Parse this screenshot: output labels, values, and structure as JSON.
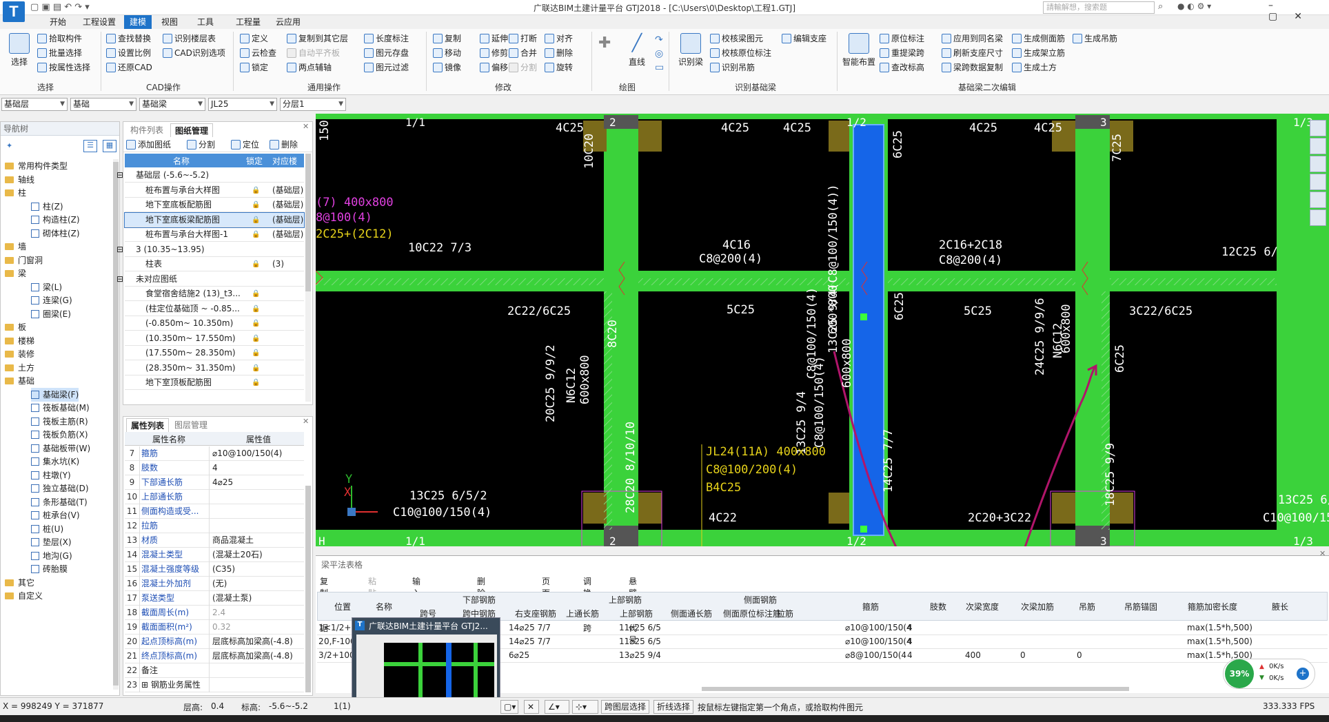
{
  "window": {
    "title": "广联达BIM土建计量平台 GTJ2018 - [C:\\Users\\0\\Desktop\\工程1.GTJ]",
    "logo": "T",
    "search_placeholder": "請輸解想，搜索题"
  },
  "menu": [
    "开始",
    "工程设置",
    "建模",
    "视图",
    "工具",
    "工程量",
    "云应用"
  ],
  "ribbon": {
    "select": {
      "label": "选择",
      "group": "选择",
      "items": [
        "拾取构件",
        "批量选择",
        "按属性选择"
      ]
    },
    "cad": {
      "group": "CAD操作",
      "items": [
        "查找替换",
        "设置比例",
        "还原CAD",
        "识别楼层表",
        "CAD识别选项"
      ]
    },
    "general": {
      "group": "通用操作",
      "items": [
        "定义",
        "云检查",
        "锁定",
        "复制到其它层",
        "自动平齐板",
        "两点辅轴",
        "长度标注",
        "图元存盘",
        "图元过滤"
      ]
    },
    "modify": {
      "group": "修改",
      "items": [
        "复制",
        "延伸",
        "打断",
        "对齐",
        "移动",
        "修剪",
        "合并",
        "删除",
        "镜像",
        "偏移",
        "分割",
        "旋转"
      ]
    },
    "draw": {
      "group": "绘图",
      "items": [
        "直线"
      ]
    },
    "recog": {
      "group": "识别基础梁",
      "items": [
        "识别梁",
        "校核梁图元",
        "校核原位标注",
        "识别吊筋",
        "编辑支座"
      ]
    },
    "beam2": {
      "group": "基础梁二次编辑",
      "items": [
        "智能布置",
        "原位标注",
        "重提梁跨",
        "查改标高",
        "应用到同名梁",
        "刷新支座尺寸",
        "梁跨数据复制",
        "生成侧面筋",
        "生成架立筋",
        "生成土方",
        "生成吊筋"
      ]
    }
  },
  "selectors": [
    "基础层",
    "基础",
    "基础梁",
    "JL25",
    "分层1"
  ],
  "nav": {
    "title": "导航树",
    "items": [
      {
        "label": "常用构件类型",
        "type": "folder"
      },
      {
        "label": "轴线",
        "type": "folder"
      },
      {
        "label": "柱",
        "type": "folder"
      },
      {
        "label": "柱(Z)",
        "type": "sub"
      },
      {
        "label": "构造柱(Z)",
        "type": "sub"
      },
      {
        "label": "砌体柱(Z)",
        "type": "sub"
      },
      {
        "label": "墙",
        "type": "folder"
      },
      {
        "label": "门窗洞",
        "type": "folder"
      },
      {
        "label": "梁",
        "type": "folder"
      },
      {
        "label": "梁(L)",
        "type": "sub"
      },
      {
        "label": "连梁(G)",
        "type": "sub"
      },
      {
        "label": "圈梁(E)",
        "type": "sub"
      },
      {
        "label": "板",
        "type": "folder"
      },
      {
        "label": "楼梯",
        "type": "folder"
      },
      {
        "label": "装修",
        "type": "folder"
      },
      {
        "label": "土方",
        "type": "folder"
      },
      {
        "label": "基础",
        "type": "folder"
      },
      {
        "label": "基础梁(F)",
        "type": "sub",
        "sel": true
      },
      {
        "label": "筏板基础(M)",
        "type": "sub"
      },
      {
        "label": "筏板主筋(R)",
        "type": "sub"
      },
      {
        "label": "筏板负筋(X)",
        "type": "sub"
      },
      {
        "label": "基础板带(W)",
        "type": "sub"
      },
      {
        "label": "集水坑(K)",
        "type": "sub"
      },
      {
        "label": "柱墩(Y)",
        "type": "sub"
      },
      {
        "label": "独立基础(D)",
        "type": "sub"
      },
      {
        "label": "条形基础(T)",
        "type": "sub"
      },
      {
        "label": "桩承台(V)",
        "type": "sub"
      },
      {
        "label": "桩(U)",
        "type": "sub"
      },
      {
        "label": "垫层(X)",
        "type": "sub"
      },
      {
        "label": "地沟(G)",
        "type": "sub"
      },
      {
        "label": "砖胎膜",
        "type": "sub"
      },
      {
        "label": "其它",
        "type": "folder"
      },
      {
        "label": "自定义",
        "type": "folder"
      }
    ]
  },
  "drawings": {
    "tabs": [
      "构件列表",
      "图纸管理"
    ],
    "tools": [
      "添加图纸",
      "分割",
      "定位",
      "删除"
    ],
    "cols": [
      "名称",
      "锁定",
      "对应楼层"
    ],
    "rows": [
      {
        "name": "基础层 (-5.6~-5.2)",
        "lock": "",
        "floor": "",
        "group": true
      },
      {
        "name": "桩布置与承台大样图",
        "lock": "🔒",
        "floor": "(基础层)"
      },
      {
        "name": "地下室底板配筋图",
        "lock": "🔒",
        "floor": "(基础层)"
      },
      {
        "name": "地下室底板梁配筋图",
        "lock": "🔒",
        "floor": "(基础层)",
        "sel": true
      },
      {
        "name": "桩布置与承台大样图-1",
        "lock": "🔒",
        "floor": "(基础层)"
      },
      {
        "name": "3 (10.35~13.95)",
        "lock": "",
        "floor": "",
        "group": true
      },
      {
        "name": "柱表",
        "lock": "🔒",
        "floor": "(3)"
      },
      {
        "name": "未对应图纸",
        "lock": "",
        "floor": "",
        "group": true
      },
      {
        "name": "食堂宿舍结施2 (13)_t3...",
        "lock": "🔒",
        "floor": ""
      },
      {
        "name": "(柱定位基础顶 ~ -0.85...",
        "lock": "🔒",
        "floor": ""
      },
      {
        "name": "(-0.850m~ 10.350m)",
        "lock": "🔒",
        "floor": ""
      },
      {
        "name": "(10.350m~ 17.550m)",
        "lock": "🔒",
        "floor": ""
      },
      {
        "name": "(17.550m~ 28.350m)",
        "lock": "🔒",
        "floor": ""
      },
      {
        "name": "(28.350m~ 31.350m)",
        "lock": "🔒",
        "floor": ""
      },
      {
        "name": "地下室顶板配筋图",
        "lock": "🔒",
        "floor": ""
      }
    ]
  },
  "props": {
    "tabs": [
      "属性列表",
      "图层管理"
    ],
    "cols": [
      "属性名称",
      "属性值"
    ],
    "rows": [
      {
        "n": "7",
        "k": "箍筋",
        "v": "⌀10@100/150(4)"
      },
      {
        "n": "8",
        "k": "肢数",
        "v": "4"
      },
      {
        "n": "9",
        "k": "下部通长筋",
        "v": "4⌀25"
      },
      {
        "n": "10",
        "k": "上部通长筋",
        "v": ""
      },
      {
        "n": "11",
        "k": "侧面构造或受...",
        "v": ""
      },
      {
        "n": "12",
        "k": "拉筋",
        "v": ""
      },
      {
        "n": "13",
        "k": "材质",
        "v": "商品混凝土"
      },
      {
        "n": "14",
        "k": "混凝土类型",
        "v": "(混凝土20石)"
      },
      {
        "n": "15",
        "k": "混凝土强度等级",
        "v": "(C35)"
      },
      {
        "n": "16",
        "k": "混凝土外加剂",
        "v": "(无)"
      },
      {
        "n": "17",
        "k": "泵送类型",
        "v": "(混凝土泵)"
      },
      {
        "n": "18",
        "k": "截面周长(m)",
        "v": "2.4",
        "gray": true
      },
      {
        "n": "19",
        "k": "截面面积(m²)",
        "v": "0.32",
        "gray": true
      },
      {
        "n": "20",
        "k": "起点顶标高(m)",
        "v": "层底标高加梁高(-4.8)"
      },
      {
        "n": "21",
        "k": "终点顶标高(m)",
        "v": "层底标高加梁高(-4.8)"
      },
      {
        "n": "22",
        "k": "备注",
        "v": "",
        "black": true
      },
      {
        "n": "23",
        "k": "⊞ 钢筋业务属性",
        "v": "",
        "black": true
      }
    ]
  },
  "cad": {
    "axes_top": [
      "1/1",
      "2",
      "1/2",
      "3",
      "1/3"
    ],
    "axes_bottom": [
      "H",
      "1/1",
      "2",
      "1/2",
      "3",
      "1/3"
    ],
    "labels": [
      {
        "t": "150",
        "c": "#fff",
        "r": true
      },
      {
        "t": "4C25",
        "c": "#fff"
      },
      {
        "t": "4C25",
        "c": "#fff"
      },
      {
        "t": "4C25",
        "c": "#fff"
      },
      {
        "t": "4C25",
        "c": "#fff"
      },
      {
        "t": "4C25",
        "c": "#fff"
      },
      {
        "t": "10C20",
        "c": "#fff",
        "r": true
      },
      {
        "t": "7C25",
        "c": "#fff",
        "r": true
      },
      {
        "t": "6C25",
        "c": "#fff",
        "r": true
      },
      {
        "t": "(7) 400x800",
        "c": "#e040e0"
      },
      {
        "t": "8@100(4)",
        "c": "#e040e0"
      },
      {
        "t": "2C25+(2C12)",
        "c": "#e6d21a"
      },
      {
        "t": "10C22 7/3",
        "c": "#fff"
      },
      {
        "t": "4C16",
        "c": "#fff"
      },
      {
        "t": "C8@200(4)",
        "c": "#fff"
      },
      {
        "t": "2C16+2C18",
        "c": "#fff"
      },
      {
        "t": "C8@200(4)",
        "c": "#fff"
      },
      {
        "t": "12C25 6/",
        "c": "#fff"
      },
      {
        "t": "2C22/6C25",
        "c": "#fff"
      },
      {
        "t": "5C25",
        "c": "#fff"
      },
      {
        "t": "5C25",
        "c": "#fff"
      },
      {
        "t": "3C22/6C25",
        "c": "#fff"
      },
      {
        "t": "8C20",
        "c": "#fff",
        "r": true
      },
      {
        "t": "6C25",
        "c": "#fff",
        "r": true
      },
      {
        "t": "6C25",
        "c": "#fff",
        "r": true
      },
      {
        "t": "20C25 9/9/2",
        "c": "#fff",
        "r": true
      },
      {
        "t": "N6C12",
        "c": "#fff",
        "r": true
      },
      {
        "t": "600x800",
        "c": "#fff",
        "r": true
      },
      {
        "t": "C8@100/150(4)",
        "c": "#fff",
        "r": true
      },
      {
        "t": "13C25 9/4(C8@100/150(4))",
        "c": "#fff",
        "r": true
      },
      {
        "t": "600*800",
        "c": "#fff",
        "r": true
      },
      {
        "t": "13C25 9/4",
        "c": "#fff",
        "r": true
      },
      {
        "t": "C8@100/150(4)",
        "c": "#fff",
        "r": true
      },
      {
        "t": "600x800",
        "c": "#fff",
        "r": true
      },
      {
        "t": "24C25 9/9/6",
        "c": "#fff",
        "r": true
      },
      {
        "t": "N6C12",
        "c": "#fff",
        "r": true
      },
      {
        "t": "600x800",
        "c": "#fff",
        "r": true
      },
      {
        "t": "JL24(11A) 400x800",
        "c": "#e6d21a"
      },
      {
        "t": "C8@100/200(4)",
        "c": "#e6d21a"
      },
      {
        "t": "B4C25",
        "c": "#e6d21a"
      },
      {
        "t": "28C20 8/10/10",
        "c": "#fff",
        "r": true
      },
      {
        "t": "14C25 7/7",
        "c": "#fff",
        "r": true
      },
      {
        "t": "18C25 9/9",
        "c": "#fff",
        "r": true
      },
      {
        "t": "13C25 6/5/2",
        "c": "#fff"
      },
      {
        "t": "C10@100/150(4)",
        "c": "#fff"
      },
      {
        "t": "4C22",
        "c": "#fff"
      },
      {
        "t": "2C20+3C22",
        "c": "#fff"
      },
      {
        "t": "13C25 6/",
        "c": "#fff"
      },
      {
        "t": "C10@100/150",
        "c": "#fff"
      },
      {
        "t": "X",
        "c": "#e03030"
      },
      {
        "t": "Y",
        "c": "#2db82d"
      }
    ]
  },
  "table": {
    "title": "梁平法表格",
    "tools": [
      "复制跨数据",
      "粘贴跨数据",
      "输入当前列数据",
      "删除当前列数据",
      "页面设置",
      "调换起始跨",
      "悬臂钢筋代号"
    ],
    "groups": [
      "下部钢筋",
      "上部钢筋",
      "侧面钢筋"
    ],
    "cols": [
      "位置",
      "名称",
      "跨号",
      "跨中钢筋",
      "右支座钢筋",
      "上通长筋",
      "上部钢筋",
      "侧面通长筋",
      "侧面原位标注筋",
      "拉筋",
      "箍筋",
      "肢数",
      "次梁宽度",
      "次梁加筋",
      "吊筋",
      "吊筋锚固",
      "箍筋加密长度",
      "腋长"
    ],
    "rows": [
      {
        "no": "1",
        "pos": "<1/2+...",
        "r": "14⌀25 7/7",
        "top": "11⌀25 6/5",
        "hoop": "⌀10@100/150(4",
        "limbs": "4",
        "w": "",
        "add": "",
        "hang": "",
        "dens": "max(1.5*h,500)"
      },
      {
        "no": "2",
        "pos": "0,F-100",
        "r": "14⌀25 7/7",
        "top": "11⌀25 6/5",
        "hoop": "⌀10@100/150(4",
        "limbs": "4",
        "w": "",
        "add": "",
        "hang": "",
        "dens": "max(1.5*h,500)"
      },
      {
        "no": "3",
        "pos": "/2+100",
        "r": "6⌀25",
        "top": "13⌀25 9/4",
        "hoop": "⌀8@100/150(4",
        "limbs": "4",
        "w": "400",
        "add": "0",
        "hang": "0",
        "dens": "max(1.5*h,500)"
      }
    ]
  },
  "popup": {
    "title": "广联达BIM土建计量平台 GTJ2..."
  },
  "netbadge": {
    "pct": "39%",
    "up": "0K/s",
    "down": "0K/s"
  },
  "status": {
    "coords": "X = 998249 Y = 371877",
    "floorh": "层高:",
    "floorh_v": "0.4",
    "elev": "标高:",
    "elev_v": "-5.6~-5.2",
    "count": "1(1)",
    "b1": "跨图层选择",
    "b2": "折线选择",
    "hint": "按鼠标左键指定第一个角点，或拾取构件图元",
    "fps": "333.333 FPS"
  }
}
